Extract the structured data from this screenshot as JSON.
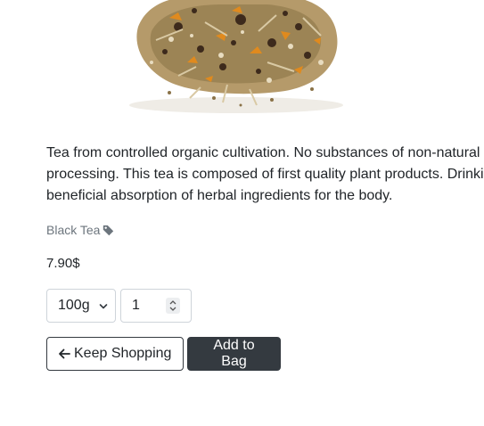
{
  "product": {
    "image_alt": "Loose leaf herbal tea blend",
    "description_lines": [
      "Tea from controlled organic cultivation. No substances of non-natural",
      "processing. This tea is composed of first quality plant products. Drinki",
      "beneficial absorption of herbal ingredients for the body."
    ],
    "category": "Black Tea",
    "price": "7.90$"
  },
  "controls": {
    "size_selected": "100g",
    "quantity_value": "1"
  },
  "actions": {
    "keep_shopping_label": "Keep Shopping",
    "add_to_bag_label": "Add to Bag"
  },
  "icons": {
    "category": "tag-icon",
    "keep_shopping": "arrow-left-icon",
    "size_select": "chevron-down-icon",
    "quantity": "spinner-icon"
  },
  "colors": {
    "dark_button": "#343a40",
    "muted_text": "#6c757d"
  }
}
